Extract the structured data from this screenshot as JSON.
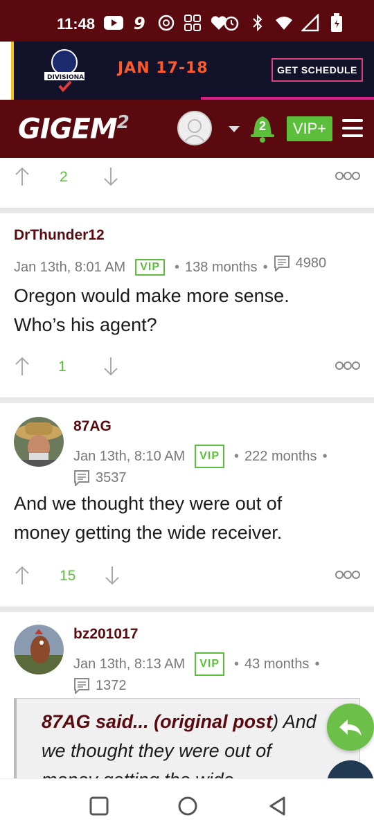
{
  "status_bar": {
    "time": "11:48",
    "left_icons": [
      "youtube-icon",
      "nine-app-icon",
      "openai-icon",
      "grid-app-icon",
      "heart-icon"
    ],
    "right_icons": [
      "alarm-icon",
      "bluetooth-icon",
      "wifi-icon",
      "signal-icon",
      "battery-icon"
    ]
  },
  "ad": {
    "league_text": "DIVISIONAL",
    "dates": "JAN 17-18",
    "cta": "GET SCHEDULE"
  },
  "header": {
    "brand": "GIGEM",
    "brand_sup": "2",
    "notification_count": "2",
    "vip_label": "VIP+",
    "colors": {
      "maroon": "#5a0a0f",
      "green": "#5cbf3c"
    }
  },
  "posts": [
    {
      "votes": "2"
    },
    {
      "username": "DrThunder12",
      "date": "Jan 13th, 8:01 AM",
      "badge": "VIP",
      "tenure": "138 months",
      "post_count": "4980",
      "body_line1": "Oregon would make more sense.",
      "body_line2": "Who’s his agent?",
      "votes": "1"
    },
    {
      "username": "87AG",
      "date": "Jan 13th, 8:10 AM",
      "badge": "VIP",
      "tenure": "222 months",
      "post_count": "3537",
      "body_line1": "And we thought they were out of",
      "body_line2": "money getting the wide receiver.",
      "votes": "15"
    },
    {
      "username": "bz201017",
      "date": "Jan 13th, 8:13 AM",
      "badge": "VIP",
      "tenure": "43 months",
      "post_count": "1372",
      "quote_prefix": "87AG said... (",
      "quote_link": "original post",
      "quote_close": ")",
      "quote_text_1": "And",
      "quote_text_2": "we thought they were out of",
      "quote_text_3": "money getting the wide"
    }
  ],
  "bullet": "•"
}
